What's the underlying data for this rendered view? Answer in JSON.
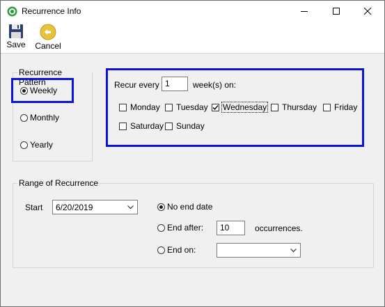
{
  "window": {
    "title": "Recurrence Info"
  },
  "toolbar": {
    "save_label": "Save",
    "cancel_label": "Cancel"
  },
  "pattern": {
    "title": "Recurrence Pattern",
    "options": [
      {
        "label": "Weekly",
        "selected": true
      },
      {
        "label": "Monthly",
        "selected": false
      },
      {
        "label": "Yearly",
        "selected": false
      }
    ]
  },
  "weekly": {
    "recur_label": "Recur every",
    "recur_value": "1",
    "weeks_on_label": "week(s) on:",
    "days": [
      {
        "label": "Monday",
        "checked": false
      },
      {
        "label": "Tuesday",
        "checked": false
      },
      {
        "label": "Wednesday",
        "checked": true
      },
      {
        "label": "Thursday",
        "checked": false
      },
      {
        "label": "Friday",
        "checked": false
      },
      {
        "label": "Saturday",
        "checked": false
      },
      {
        "label": "Sunday",
        "checked": false
      }
    ]
  },
  "range": {
    "title": "Range of Recurrence",
    "start_label": "Start",
    "start_value": "6/20/2019",
    "no_end_label": "No end date",
    "end_after_label": "End after:",
    "end_after_value": "10",
    "occurrences_label": "occurrences.",
    "end_on_label": "End on:",
    "end_on_value": "",
    "selected": "No end date"
  },
  "colors": {
    "highlight": "#0c14d6"
  }
}
